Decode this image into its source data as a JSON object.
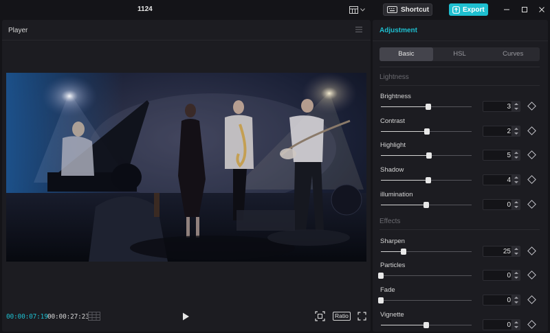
{
  "window": {
    "title": "1124"
  },
  "titlebar": {
    "shortcut_label": "Shortcut",
    "export_label": "Export",
    "accent": "#1ebfd0"
  },
  "player": {
    "title": "Player",
    "time_current": "00:00:07:19",
    "time_total": "00:00:27:23",
    "ratio_label": "Ratio"
  },
  "adjustment": {
    "title": "Adjustment",
    "tabs": [
      {
        "label": "Basic",
        "active": true
      },
      {
        "label": "HSL",
        "active": false
      },
      {
        "label": "Curves",
        "active": false
      }
    ],
    "sections": {
      "lightness": "Lightness",
      "effects": "Effects"
    },
    "controls": [
      {
        "label": "Brightness",
        "value": "3",
        "level": 0.52
      },
      {
        "label": "Contrast",
        "value": "2",
        "level": 0.51
      },
      {
        "label": "Highlight",
        "value": "5",
        "level": 0.53
      },
      {
        "label": "Shadow",
        "value": "4",
        "level": 0.52
      },
      {
        "label": "illumination",
        "value": "0",
        "level": 0.5
      },
      {
        "label": "Sharpen",
        "value": "25",
        "level": 0.25
      },
      {
        "label": "Particles",
        "value": "0",
        "level": 0.0
      },
      {
        "label": "Fade",
        "value": "0",
        "level": 0.0
      },
      {
        "label": "Vignette",
        "value": "0",
        "level": 0.5
      }
    ]
  }
}
